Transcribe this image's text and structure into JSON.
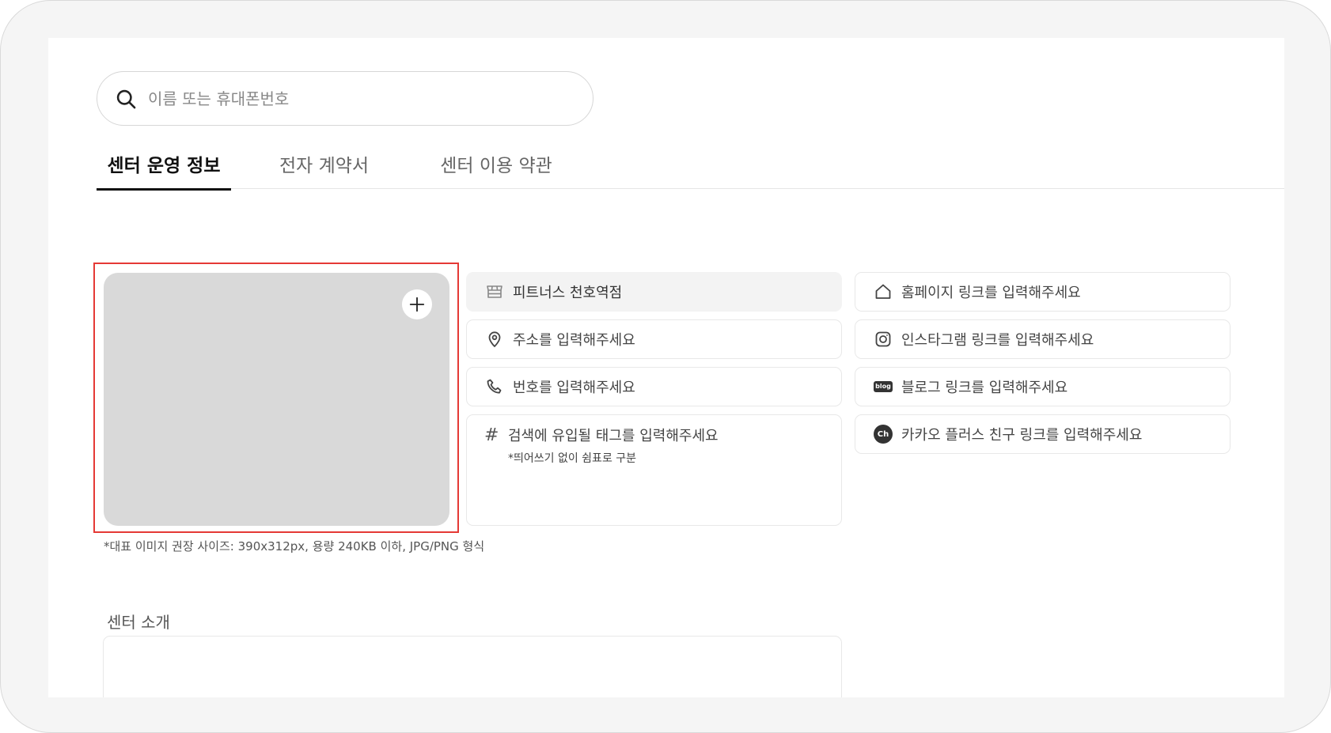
{
  "search": {
    "placeholder": "이름 또는 휴대폰번호",
    "icon": "search-icon"
  },
  "tabs": [
    {
      "label": "센터 운영 정보",
      "active": true
    },
    {
      "label": "전자 계약서",
      "active": false
    },
    {
      "label": "센터 이용 약관",
      "active": false
    }
  ],
  "image_upload": {
    "note": "*대표 이미지 권장 사이즈: 390x312px, 용량 240KB 이하, JPG/PNG 형식"
  },
  "fields": {
    "center_name": {
      "value": "피트너스 천호역점",
      "icon": "store-icon"
    },
    "address": {
      "placeholder": "주소를 입력해주세요",
      "icon": "map-pin-icon"
    },
    "phone": {
      "placeholder": "번호를 입력해주세요",
      "icon": "phone-icon"
    },
    "tags": {
      "placeholder": "검색에 유입될 태그를 입력해주세요",
      "hint": "*띄어쓰기 없이 쉼표로 구분",
      "icon_text": "#"
    },
    "homepage": {
      "placeholder": "홈페이지 링크를 입력해주세요",
      "icon": "home-icon"
    },
    "instagram": {
      "placeholder": "인스타그램 링크를 입력해주세요",
      "icon": "instagram-icon"
    },
    "blog": {
      "placeholder": "블로그 링크를 입력해주세요",
      "icon": "blog-icon",
      "badge": "blog"
    },
    "kakao": {
      "placeholder": "카카오 플러스 친구 링크를 입력해주세요",
      "icon": "kakao-channel-icon",
      "badge": "Ch"
    }
  },
  "intro": {
    "label": "센터 소개"
  },
  "colors": {
    "highlight_border": "#e53935",
    "image_placeholder": "#d9d9d9"
  }
}
